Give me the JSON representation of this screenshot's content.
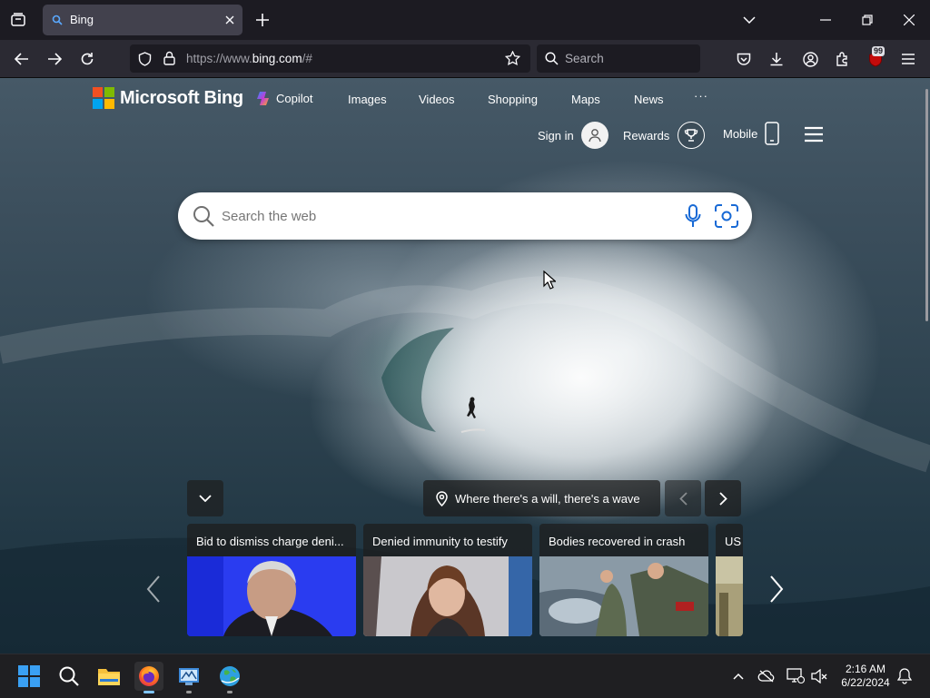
{
  "browser": {
    "tab": {
      "title": "Bing"
    },
    "url": {
      "prefix": "https://www.",
      "domain": "bing.com",
      "suffix": "/#"
    },
    "search_placeholder": "Search",
    "extension_badge": "99"
  },
  "bing": {
    "logo_text": "Microsoft Bing",
    "nav": {
      "copilot": "Copilot",
      "images": "Images",
      "videos": "Videos",
      "shopping": "Shopping",
      "maps": "Maps",
      "news": "News",
      "more": "···"
    },
    "account": {
      "sign_in": "Sign in",
      "rewards": "Rewards",
      "mobile": "Mobile"
    },
    "search_placeholder": "Search the web",
    "image_caption": "Where there's a will, there's a wave",
    "news": [
      {
        "title": "Bid to dismiss charge deni..."
      },
      {
        "title": "Denied immunity to testify"
      },
      {
        "title": "Bodies recovered in crash"
      },
      {
        "title": "US"
      }
    ]
  },
  "taskbar": {
    "time": "2:16 AM",
    "date": "6/22/2024"
  },
  "colors": {
    "ms_red": "#f25022",
    "ms_green": "#7fba00",
    "ms_blue": "#00a4ef",
    "ms_yellow": "#ffb900",
    "chrome_dark": "#1c1b22",
    "toolbar": "#2b2a33"
  }
}
